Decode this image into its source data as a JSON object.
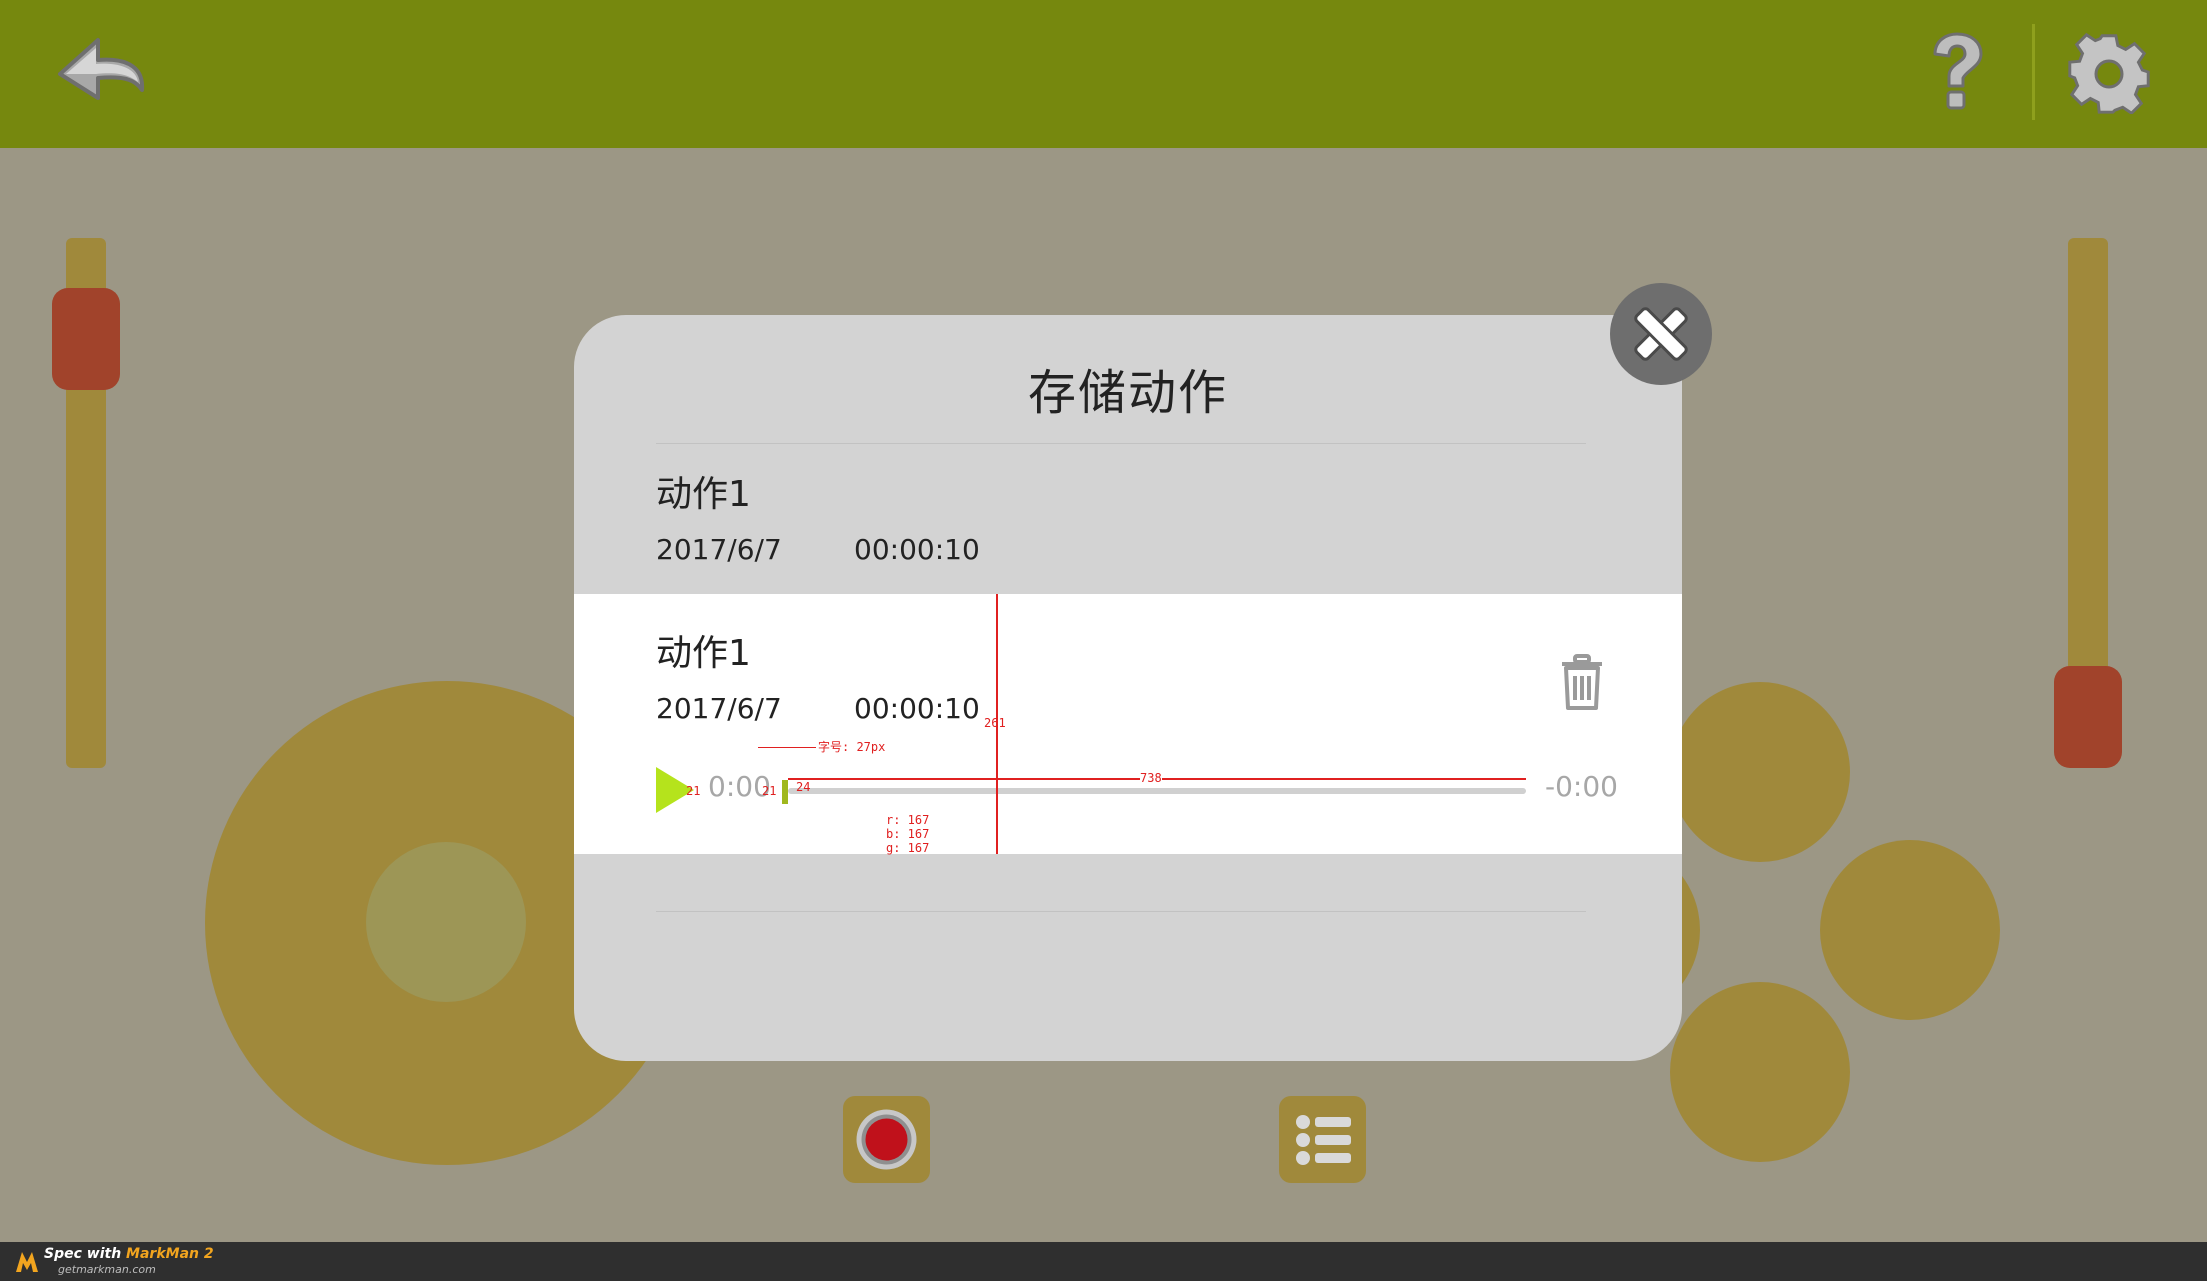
{
  "header": {
    "back_icon": "arrow-left-icon",
    "help_icon": "question-mark-icon",
    "settings_icon": "gear-icon"
  },
  "modal": {
    "title": "存储动作",
    "items": [
      {
        "name": "动作1",
        "date": "2017/6/7",
        "duration": "00:00:10"
      },
      {
        "name": "动作1",
        "date": "2017/6/7",
        "duration": "00:00:10"
      }
    ],
    "player": {
      "current_time": "0:00",
      "remaining_time": "-0:00",
      "progress": 0
    },
    "annotations": {
      "height": "261",
      "width": "738",
      "gap_left": "21",
      "gap_mid": "21",
      "handle_height": "24",
      "font_size": "字号: 27px",
      "color_r": "r: 167",
      "color_b": "b: 167",
      "color_g": "g: 167"
    }
  },
  "footer": {
    "spec_prefix": "Spec with ",
    "brand": "MarkMan 2",
    "url": "getmarkman.com"
  },
  "colors": {
    "topbar": "#76880e",
    "background": "#9c9785",
    "accent": "#a0893b",
    "knob": "#a1432b",
    "play": "#b5e31c",
    "record": "#c0111b"
  }
}
